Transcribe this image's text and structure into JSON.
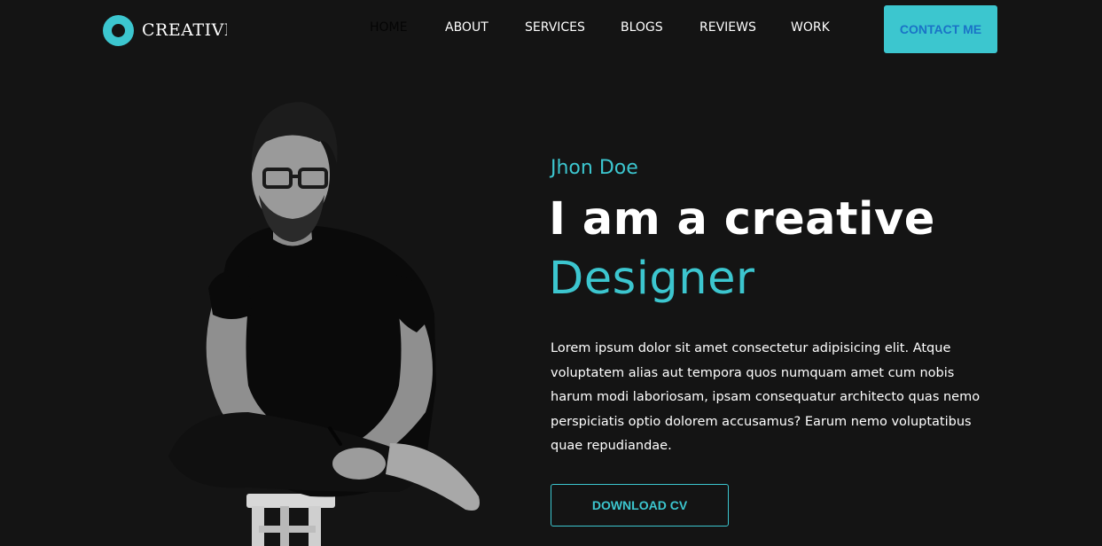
{
  "header": {
    "logo_text": "CREATIVE",
    "nav": {
      "home": "HOME",
      "about": "ABOUT",
      "services": "SERVICES",
      "blogs": "BLOGS",
      "reviews": "REVIEWS",
      "work": "WORK"
    },
    "contact_label": "CONTACT ME"
  },
  "hero": {
    "name": "Jhon Doe",
    "headline_line1": "I am a creative",
    "headline_line2": "Designer",
    "description": "Lorem ipsum dolor sit amet consectetur adipisicing elit. Atque voluptatem alias aut tempora quos numquam amet cum nobis harum modi laboriosam, ipsam consequatur architecto quas nemo perspiciatis optio dolorem accusamus? Earum nemo voluptatibus quae repudiandae.",
    "download_label": "DOWNLOAD CV",
    "photo_icon": "person-portrait-icon"
  },
  "colors": {
    "accent": "#3cc6cf",
    "background": "#141414",
    "contact_text": "#1a73c7"
  }
}
